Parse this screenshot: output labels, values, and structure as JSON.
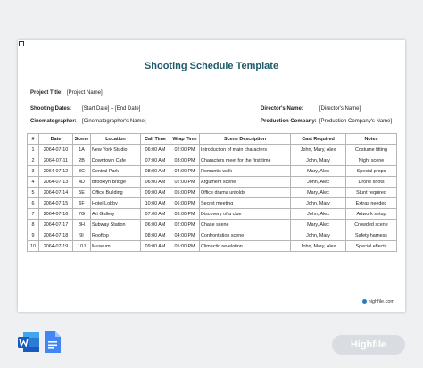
{
  "document": {
    "title": "Shooting Schedule Template",
    "fields": {
      "project_title_label": "Project Title:",
      "project_title_value": "[Project Name]",
      "shooting_dates_label": "Shooting Dates:",
      "shooting_dates_value": "[Start Date] – [End Date]",
      "cinematographer_label": "Cinematographer:",
      "cinematographer_value": "[Cinematographer's Name]",
      "director_label": "Director's Name:",
      "director_value": "[Director's Name]",
      "production_company_label": "Production Company:",
      "production_company_value": "[Production Company's Name]"
    },
    "columns": [
      "#",
      "Date",
      "Scene",
      "Location",
      "Call Time",
      "Wrap Time",
      "Scene Description",
      "Cast Required",
      "Notes"
    ],
    "rows": [
      [
        "1",
        "2064-07-10",
        "1A",
        "New York Studio",
        "06:00 AM",
        "02:00 PM",
        "Introduction of main characters",
        "John, Mary, Alex",
        "Costume fitting"
      ],
      [
        "2",
        "2064-07-11",
        "2B",
        "Downtown Cafe",
        "07:00 AM",
        "03:00 PM",
        "Characters meet for the first time",
        "John, Mary",
        "Night scene"
      ],
      [
        "3",
        "2064-07-12",
        "3C",
        "Central Park",
        "08:00 AM",
        "04:00 PM",
        "Romantic walk",
        "Mary, Alex",
        "Special props"
      ],
      [
        "4",
        "2064-07-13",
        "4D",
        "Brooklyn Bridge",
        "06:00 AM",
        "02:00 PM",
        "Argument scene",
        "John, Alex",
        "Drone shots"
      ],
      [
        "5",
        "2064-07-14",
        "5E",
        "Office Building",
        "09:00 AM",
        "05:00 PM",
        "Office drama unfolds",
        "Mary, Alex",
        "Stunt required"
      ],
      [
        "6",
        "2064-07-15",
        "6F",
        "Hotel Lobby",
        "10:00 AM",
        "06:00 PM",
        "Secret meeting",
        "John, Mary",
        "Extras needed"
      ],
      [
        "7",
        "2064-07-16",
        "7G",
        "Art Gallery",
        "07:00 AM",
        "03:00 PM",
        "Discovery of a clue",
        "John, Alex",
        "Artwork setup"
      ],
      [
        "8",
        "2064-07-17",
        "8H",
        "Subway Station",
        "06:00 AM",
        "02:00 PM",
        "Chase scene",
        "Mary, Alex",
        "Crowded scene"
      ],
      [
        "9",
        "2064-07-18",
        "9I",
        "Rooftop",
        "08:00 AM",
        "04:00 PM",
        "Confrontation scene",
        "John, Mary",
        "Safety harness"
      ],
      [
        "10",
        "2064-07-19",
        "10J",
        "Museum",
        "09:00 AM",
        "05:00 PM",
        "Climactic revelation",
        "John, Mary, Alex",
        "Special effects"
      ]
    ],
    "footer": "highfile.com"
  },
  "brand": "Highfile",
  "icons": [
    "word-icon",
    "google-docs-icon"
  ]
}
